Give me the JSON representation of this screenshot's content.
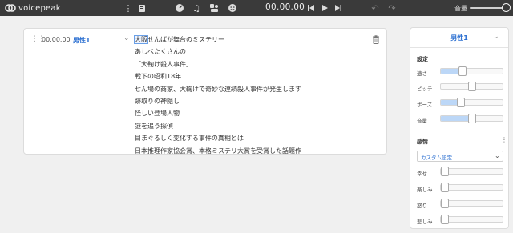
{
  "app": {
    "name": "voicepeak",
    "time": "00.00.00",
    "volume_label": "音量"
  },
  "editor": {
    "row_time": "00.00.00",
    "voice": "男性1",
    "first_highlight": "大阪",
    "first_rest": "せんばが舞台のミステリー",
    "lines": [
      "あしべたくさんの",
      "「大鞠け殺人事件」",
      "戦下の昭和18年",
      "せん場の商家、大鞠けで奇妙な連続殺人事件が発生します",
      "跡取りの神隠し",
      "怪しい登場人物",
      "謎を追う探偵",
      "目まぐるしく変化する事件の真相とは",
      "日本推理作家協会賞、本格ミステリ大賞を受賞した話題作"
    ]
  },
  "panel": {
    "voice": "男性1",
    "settings_title": "設定",
    "params": [
      {
        "label": "速さ",
        "value": 0.35
      },
      {
        "label": "ピッチ",
        "value": 0.5
      },
      {
        "label": "ポーズ",
        "value": 0.33
      },
      {
        "label": "音量",
        "value": 0.5
      }
    ],
    "emotion_title": "感情",
    "emotion_preset": "カスタム設定",
    "emotions": [
      {
        "label": "幸せ",
        "value": 0
      },
      {
        "label": "楽しみ",
        "value": 0
      },
      {
        "label": "怒り",
        "value": 0
      },
      {
        "label": "悲しみ",
        "value": 0
      }
    ],
    "colors": {
      "accent": "#2b6fd1",
      "fill": "#bcd7f7"
    }
  }
}
